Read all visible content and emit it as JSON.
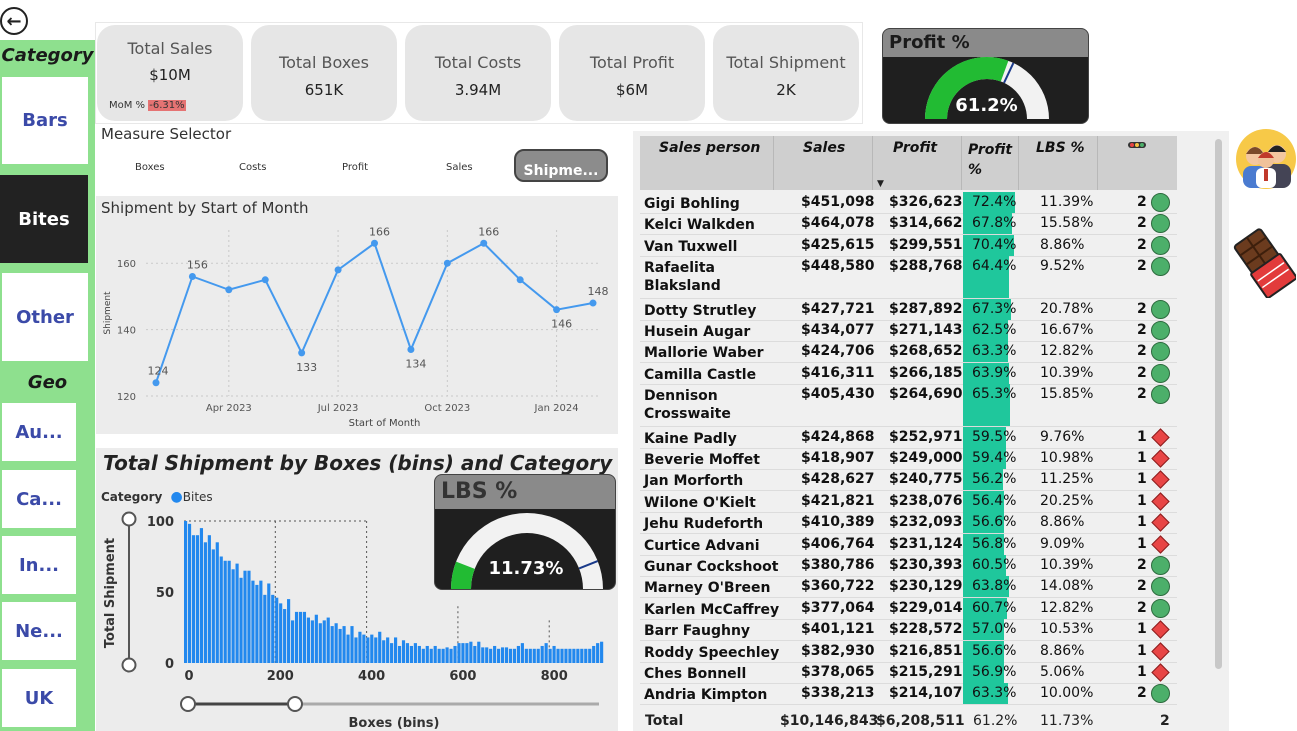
{
  "category": {
    "title": "Category",
    "items": [
      {
        "label": "Bars",
        "selected": false
      },
      {
        "label": "Bites",
        "selected": true
      },
      {
        "label": "Other",
        "selected": false
      }
    ]
  },
  "geo": {
    "title": "Geo",
    "items": [
      "Au...",
      "Ca...",
      "In...",
      "Ne...",
      "UK"
    ]
  },
  "kpis": [
    {
      "title": "Total Sales",
      "value": "$10M",
      "mom_label": "MoM %",
      "mom_value": "-6.31%"
    },
    {
      "title": "Total Boxes",
      "value": "651K"
    },
    {
      "title": "Total Costs",
      "value": "3.94M"
    },
    {
      "title": "Total Profit",
      "value": "$6M"
    },
    {
      "title": "Total Shipment",
      "value": "2K"
    }
  ],
  "profit_gauge": {
    "title": "Profit %",
    "value": "61.2%",
    "fraction": 0.612,
    "fill_color": "#22bb33"
  },
  "lbs_gauge": {
    "title": "LBS %",
    "value": "11.73%",
    "fraction": 0.1173,
    "fill_color": "#22bb33"
  },
  "measure_selector": {
    "title": "Measure Selector",
    "options": [
      "Boxes",
      "Costs",
      "Profit",
      "Sales"
    ],
    "selected": "Shipme..."
  },
  "chart_data": [
    {
      "type": "line",
      "title": "Shipment by Start of Month",
      "xlabel": "Start of Month",
      "ylabel": "Shipment",
      "x": [
        "2023-02",
        "2023-03",
        "2023-04",
        "2023-05",
        "2023-06",
        "2023-07",
        "2023-08",
        "2023-09",
        "2023-10",
        "2023-11",
        "2023-12",
        "2024-01",
        "2024-02"
      ],
      "values": [
        124,
        156,
        152,
        155,
        133,
        158,
        166,
        134,
        160,
        166,
        155,
        146,
        148
      ],
      "point_labels": [
        "124",
        "156",
        "",
        "",
        "133",
        "",
        "166",
        "134",
        "",
        "166",
        "",
        "146",
        "148"
      ],
      "x_ticks": [
        "Apr 2023",
        "Jul 2023",
        "Oct 2023",
        "Jan 2024"
      ],
      "y_ticks": [
        "120",
        "140",
        "160"
      ],
      "ylim": [
        120,
        170
      ],
      "grid": true,
      "color": "#4499ee"
    },
    {
      "type": "bar",
      "title": "Total Shipment by Boxes (bins) and Category",
      "legend_title": "Category",
      "series_name": "Bites",
      "xlabel": "Boxes (bins)",
      "ylabel": "Total Shipment",
      "x_ticks": [
        "0",
        "200",
        "400",
        "600",
        "800"
      ],
      "y_ticks": [
        "0",
        "50",
        "100"
      ],
      "xlim": [
        0,
        920
      ],
      "ylim": [
        0,
        100
      ],
      "bin_width": 20,
      "values": [
        100,
        98,
        90,
        90,
        95,
        85,
        90,
        80,
        85,
        75,
        72,
        72,
        66,
        70,
        60,
        65,
        65,
        58,
        55,
        58,
        48,
        56,
        48,
        46,
        42,
        38,
        45,
        30,
        36,
        36,
        36,
        32,
        30,
        34,
        28,
        30,
        32,
        26,
        28,
        24,
        26,
        20,
        26,
        18,
        22,
        20,
        18,
        20,
        18,
        22,
        16,
        18,
        14,
        18,
        12,
        16,
        14,
        12,
        14,
        12,
        10,
        12,
        10,
        12,
        10,
        10,
        11,
        10,
        12,
        14,
        14,
        14,
        15,
        12,
        15,
        11,
        11,
        10,
        12,
        10,
        11,
        11,
        10,
        10,
        12,
        14,
        10,
        10,
        10,
        10,
        12,
        14,
        10,
        12,
        10,
        10,
        10,
        10,
        10,
        10,
        10,
        10,
        10,
        12,
        14,
        15
      ],
      "color": "#2288ee"
    }
  ],
  "table": {
    "headers": [
      "Sales person",
      "Sales",
      "Profit",
      "Profit %",
      "LBS %",
      ""
    ],
    "rows": [
      {
        "name": "Gigi Bohling",
        "sales": "$451,098",
        "profit": "$326,623",
        "profit_pct": "72.4%",
        "profit_frac": 0.724,
        "lbs": "11.39%",
        "n": "2",
        "status": "green-circle"
      },
      {
        "name": "Kelci Walkden",
        "sales": "$464,078",
        "profit": "$314,662",
        "profit_pct": "67.8%",
        "profit_frac": 0.678,
        "lbs": "15.58%",
        "n": "2",
        "status": "green-circle"
      },
      {
        "name": "Van Tuxwell",
        "sales": "$425,615",
        "profit": "$299,551",
        "profit_pct": "70.4%",
        "profit_frac": 0.704,
        "lbs": "8.86%",
        "n": "2",
        "status": "green-circle"
      },
      {
        "name": "Rafaelita",
        "name2": "Blaksland",
        "sales": "$448,580",
        "profit": "$288,768",
        "profit_pct": "64.4%",
        "profit_frac": 0.644,
        "lbs": "9.52%",
        "n": "2",
        "status": "green-circle"
      },
      {
        "name": "Dotty Strutley",
        "sales": "$427,721",
        "profit": "$287,892",
        "profit_pct": "67.3%",
        "profit_frac": 0.673,
        "lbs": "20.78%",
        "n": "2",
        "status": "green-circle"
      },
      {
        "name": "Husein Augar",
        "sales": "$434,077",
        "profit": "$271,143",
        "profit_pct": "62.5%",
        "profit_frac": 0.625,
        "lbs": "16.67%",
        "n": "2",
        "status": "green-circle"
      },
      {
        "name": "Mallorie Waber",
        "sales": "$424,706",
        "profit": "$268,652",
        "profit_pct": "63.3%",
        "profit_frac": 0.633,
        "lbs": "12.82%",
        "n": "2",
        "status": "green-circle"
      },
      {
        "name": "Camilla Castle",
        "sales": "$416,311",
        "profit": "$266,185",
        "profit_pct": "63.9%",
        "profit_frac": 0.639,
        "lbs": "10.39%",
        "n": "2",
        "status": "green-circle"
      },
      {
        "name": "Dennison",
        "name2": "Crosswaite",
        "sales": "$405,430",
        "profit": "$264,690",
        "profit_pct": "65.3%",
        "profit_frac": 0.653,
        "lbs": "15.85%",
        "n": "2",
        "status": "green-circle"
      },
      {
        "name": "Kaine Padly",
        "sales": "$424,868",
        "profit": "$252,971",
        "profit_pct": "59.5%",
        "profit_frac": 0.595,
        "lbs": "9.76%",
        "n": "1",
        "status": "red-diamond"
      },
      {
        "name": "Beverie Moffet",
        "sales": "$418,907",
        "profit": "$249,000",
        "profit_pct": "59.4%",
        "profit_frac": 0.594,
        "lbs": "10.98%",
        "n": "1",
        "status": "red-diamond"
      },
      {
        "name": "Jan Morforth",
        "sales": "$428,627",
        "profit": "$240,775",
        "profit_pct": "56.2%",
        "profit_frac": 0.562,
        "lbs": "11.25%",
        "n": "1",
        "status": "red-diamond"
      },
      {
        "name": "Wilone O'Kielt",
        "sales": "$421,821",
        "profit": "$238,076",
        "profit_pct": "56.4%",
        "profit_frac": 0.564,
        "lbs": "20.25%",
        "n": "1",
        "status": "red-diamond"
      },
      {
        "name": "Jehu Rudeforth",
        "sales": "$410,389",
        "profit": "$232,093",
        "profit_pct": "56.6%",
        "profit_frac": 0.566,
        "lbs": "8.86%",
        "n": "1",
        "status": "red-diamond"
      },
      {
        "name": "Curtice Advani",
        "sales": "$406,764",
        "profit": "$231,124",
        "profit_pct": "56.8%",
        "profit_frac": 0.568,
        "lbs": "9.09%",
        "n": "1",
        "status": "red-diamond"
      },
      {
        "name": "Gunar Cockshoot",
        "sales": "$380,786",
        "profit": "$230,393",
        "profit_pct": "60.5%",
        "profit_frac": 0.605,
        "lbs": "10.39%",
        "n": "2",
        "status": "green-circle"
      },
      {
        "name": "Marney O'Breen",
        "sales": "$360,722",
        "profit": "$230,129",
        "profit_pct": "63.8%",
        "profit_frac": 0.638,
        "lbs": "14.08%",
        "n": "2",
        "status": "green-circle"
      },
      {
        "name": "Karlen McCaffrey",
        "sales": "$377,064",
        "profit": "$229,014",
        "profit_pct": "60.7%",
        "profit_frac": 0.607,
        "lbs": "12.82%",
        "n": "2",
        "status": "green-circle"
      },
      {
        "name": "Barr Faughny",
        "sales": "$401,121",
        "profit": "$228,572",
        "profit_pct": "57.0%",
        "profit_frac": 0.57,
        "lbs": "10.53%",
        "n": "1",
        "status": "red-diamond"
      },
      {
        "name": "Roddy Speechley",
        "sales": "$382,930",
        "profit": "$216,851",
        "profit_pct": "56.6%",
        "profit_frac": 0.566,
        "lbs": "8.86%",
        "n": "1",
        "status": "red-diamond"
      },
      {
        "name": "Ches Bonnell",
        "sales": "$378,065",
        "profit": "$215,291",
        "profit_pct": "56.9%",
        "profit_frac": 0.569,
        "lbs": "5.06%",
        "n": "1",
        "status": "red-diamond"
      },
      {
        "name": "Andria Kimpton",
        "sales": "$338,213",
        "profit": "$214,107",
        "profit_pct": "63.3%",
        "profit_frac": 0.633,
        "lbs": "10.00%",
        "n": "2",
        "status": "green-circle"
      }
    ],
    "total": {
      "label": "Total",
      "sales": "$10,146,843",
      "profit": "$6,208,511",
      "profit_pct": "61.2%",
      "lbs": "11.73%",
      "n": "2"
    }
  },
  "colors": {
    "accent_green": "#8ee08e",
    "databar": "#1fc79c",
    "status_green": "#4caf6a",
    "status_red": "#e84545",
    "mom_bad": "#e57373"
  },
  "icons": {
    "team": "team-avatar-icon",
    "chocolate": "chocolate-bar-icon",
    "back": "back-arrow-icon"
  }
}
